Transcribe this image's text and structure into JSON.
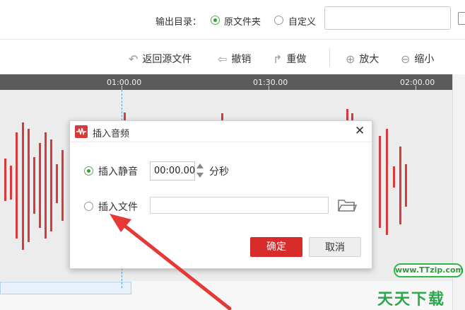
{
  "output_row": {
    "label": "输出目录：",
    "option_original": "原文件夹",
    "option_custom": "自定义",
    "path_value": ""
  },
  "toolbar": {
    "back_to_source": "返回源文件",
    "undo": "撤销",
    "redo": "重做",
    "zoom_in": "放大",
    "zoom_out": "缩小"
  },
  "timeline": {
    "ticks": [
      "01:00.00",
      "01:30.00",
      "02:00.00"
    ]
  },
  "dialog": {
    "title": "插入音频",
    "close": "✕",
    "option_silence": "插入静音",
    "silence_value": "00:00.00",
    "unit": "分秒",
    "option_file": "插入文件",
    "file_value": "",
    "ok": "确定",
    "cancel": "取消",
    "selected_option": "插入静音"
  },
  "watermark": {
    "url": "www.TTzip.com",
    "text": "天天下载"
  },
  "colors": {
    "waveform": "#d63a3a",
    "ok_button": "#d82b2b",
    "radio_checked": "#3a9a3a",
    "annotation_arrow": "#e53935",
    "watermark": "#2aa84a"
  }
}
